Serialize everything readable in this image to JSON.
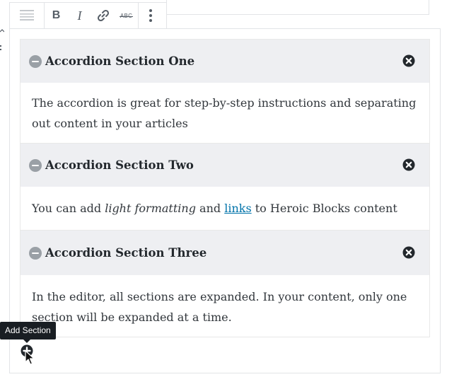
{
  "toolbar": {
    "items": [
      {
        "name": "block-type-icon"
      },
      {
        "name": "bold-icon"
      },
      {
        "name": "italic-icon"
      },
      {
        "name": "link-icon"
      },
      {
        "name": "strikethrough-icon"
      },
      {
        "name": "more-options-icon"
      }
    ]
  },
  "accordion": {
    "sections": [
      {
        "title": "Accordion Section One",
        "body": "The accordion is great for step-by-step instructions and separating out content in your articles"
      },
      {
        "title": "Accordion Section Two",
        "body_parts": {
          "t1": "You can add ",
          "em": "light formatting",
          "t2": " and ",
          "link": "links",
          "t3": " to Heroic Blocks content"
        }
      },
      {
        "title": "Accordion Section Three",
        "body": "In the editor, all sections are expanded. In your content, only one section will be expanded at a time."
      }
    ]
  },
  "add_section": {
    "tooltip": "Add Section"
  },
  "toolbar_glyphs": {
    "bold": "B",
    "italic": "I",
    "strikethrough": "ABC"
  },
  "colors": {
    "header_bg": "#eeeff2",
    "link": "#0073aa",
    "icon": "#23282d"
  }
}
